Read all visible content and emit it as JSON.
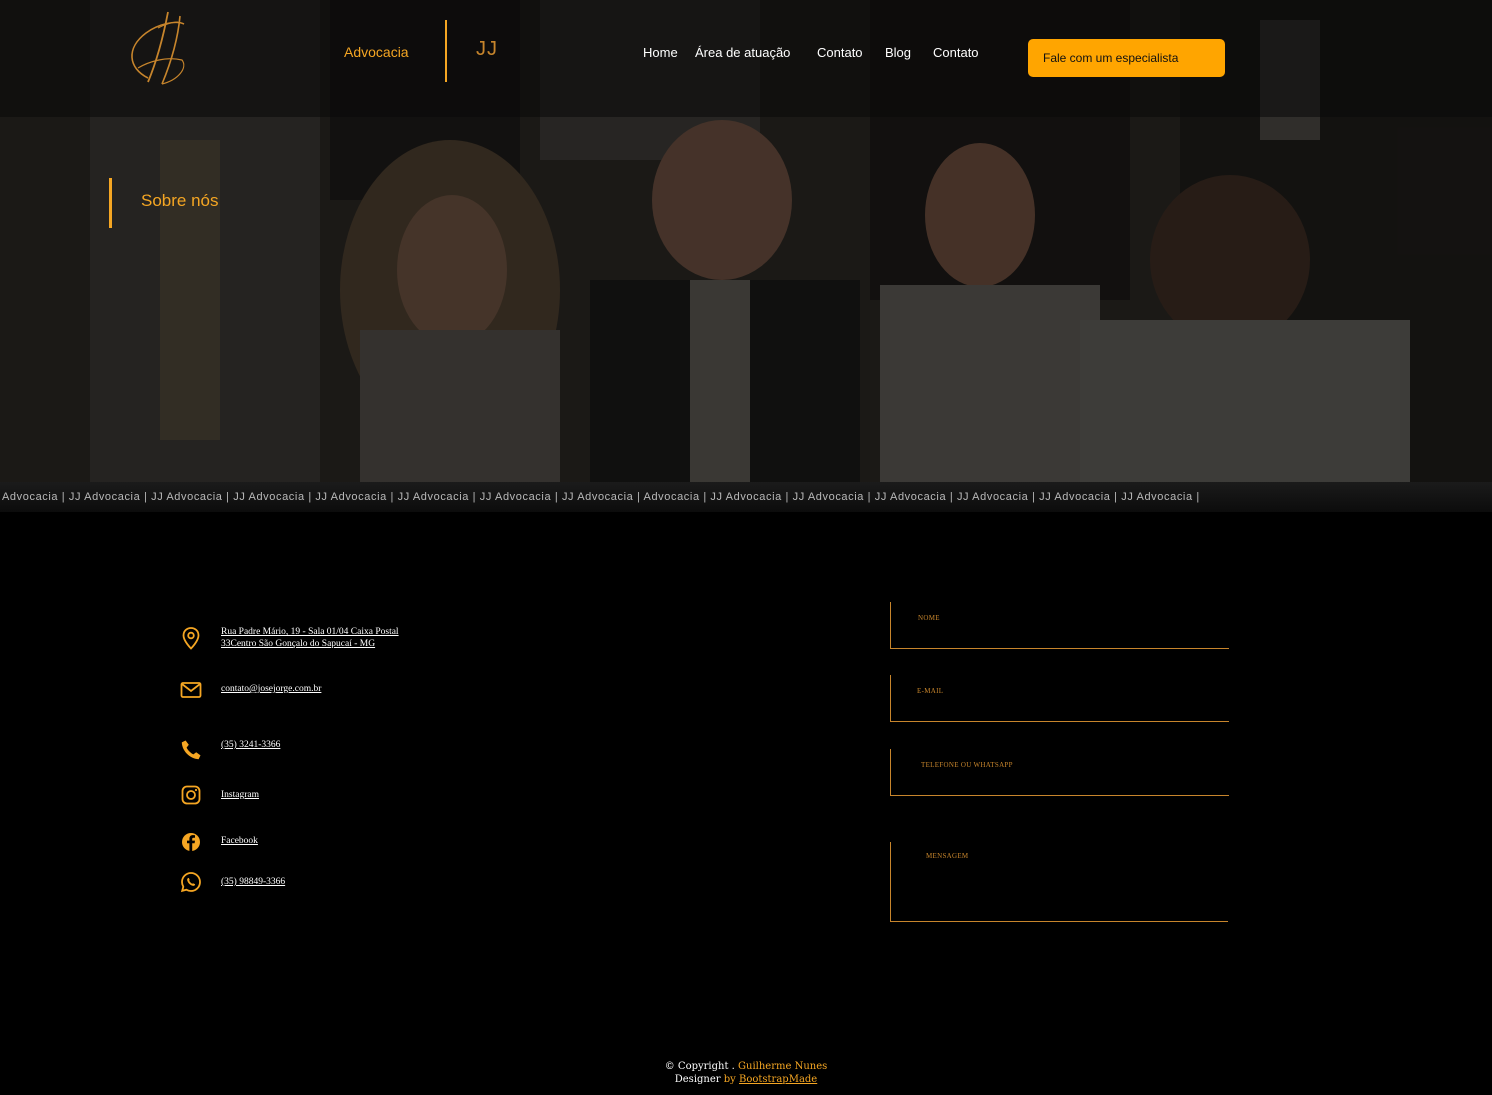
{
  "header": {
    "brand_left": "Advocacia",
    "brand_right": "JJ",
    "nav": [
      "Home",
      "Área de atuação",
      "Contato",
      "Blog",
      "Contato"
    ],
    "cta_label": "Fale com um especialista"
  },
  "hero": {
    "title": "Sobre nós"
  },
  "ticker": {
    "text": "Advocacia | JJ Advocacia | JJ Advocacia | JJ Advocacia | JJ Advocacia | JJ Advocacia | JJ Advocacia | JJ Advocacia | Advocacia | JJ Advocacia | JJ Advocacia | JJ Advocacia | JJ Advocacia | JJ Advocacia | JJ Advocacia |"
  },
  "contact": {
    "address_line1": "Rua Padre Mário, 19 - Sala 01/04 Caixa Postal",
    "address_line2": "33Centro São Gonçalo do Sapucaí - MG",
    "email": "contato@josejorge.com.br",
    "phone": "(35) 3241-3366",
    "instagram": "Instagram",
    "facebook": "Facebook",
    "whatsapp": "(35) 98849-3366"
  },
  "form": {
    "name_label": "NOME",
    "email_label": "E-MAIL",
    "phone_label": "TELEFONE OU WHATSAPP",
    "message_label": "MENSAGEM"
  },
  "footer": {
    "copyright_prefix": "© Copyright .",
    "author": "Guilherme Nunes",
    "designer_prefix": "Designer",
    "by": "by",
    "designer_link": "BootstrapMade"
  },
  "colors": {
    "accent": "#f5a623",
    "cta": "#ffa500",
    "background": "#000000"
  }
}
